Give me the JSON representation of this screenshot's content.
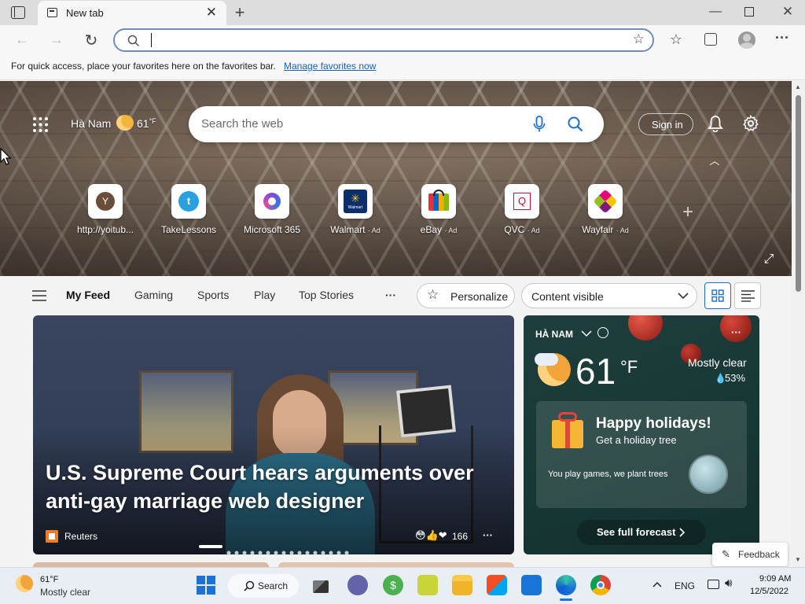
{
  "browser": {
    "tab_title": "New tab",
    "address_value": "",
    "favorites_message": "For quick access, place your favorites here on the favorites bar.",
    "favorites_link": "Manage favorites now"
  },
  "hero": {
    "location": "Hà Nam",
    "temperature": "61",
    "temp_unit": "°F",
    "search_placeholder": "Search the web",
    "sign_in": "Sign in",
    "tiles": [
      {
        "label": "http://yoitub...",
        "ad": "",
        "letter": "Y"
      },
      {
        "label": "TakeLessons",
        "ad": ""
      },
      {
        "label": "Microsoft 365",
        "ad": ""
      },
      {
        "label": "Walmart",
        "ad": "· Ad",
        "inner": "Walmart"
      },
      {
        "label": "eBay",
        "ad": "· Ad"
      },
      {
        "label": "QVC",
        "ad": "· Ad",
        "inner": "Q"
      },
      {
        "label": "Wayfair",
        "ad": "· Ad"
      }
    ]
  },
  "feed_nav": {
    "items": [
      "My Feed",
      "Gaming",
      "Sports",
      "Play",
      "Top Stories"
    ],
    "more": "···",
    "personalize": "Personalize",
    "content_visible": "Content visible"
  },
  "main_story": {
    "headline_line1": "U.S. Supreme Court hears arguments over",
    "headline_line2": "anti-gay marriage web designer",
    "source": "Reuters",
    "reactions": "166",
    "more": "···"
  },
  "weather": {
    "location": "HÀ NAM",
    "temp": "61",
    "unit": "°F",
    "condition": "Mostly clear",
    "humidity": "53%",
    "promo_title": "Happy holidays!",
    "promo_sub": "Get a holiday tree",
    "promo_text": "You play games, we plant trees",
    "forecast_button": "See full forecast",
    "more": "···"
  },
  "feedback": "Feedback",
  "taskbar": {
    "weather_temp": "61°F",
    "weather_cond": "Mostly clear",
    "search": "Search",
    "lang": "ENG",
    "time": "9:09 AM",
    "date": "12/5/2022"
  }
}
